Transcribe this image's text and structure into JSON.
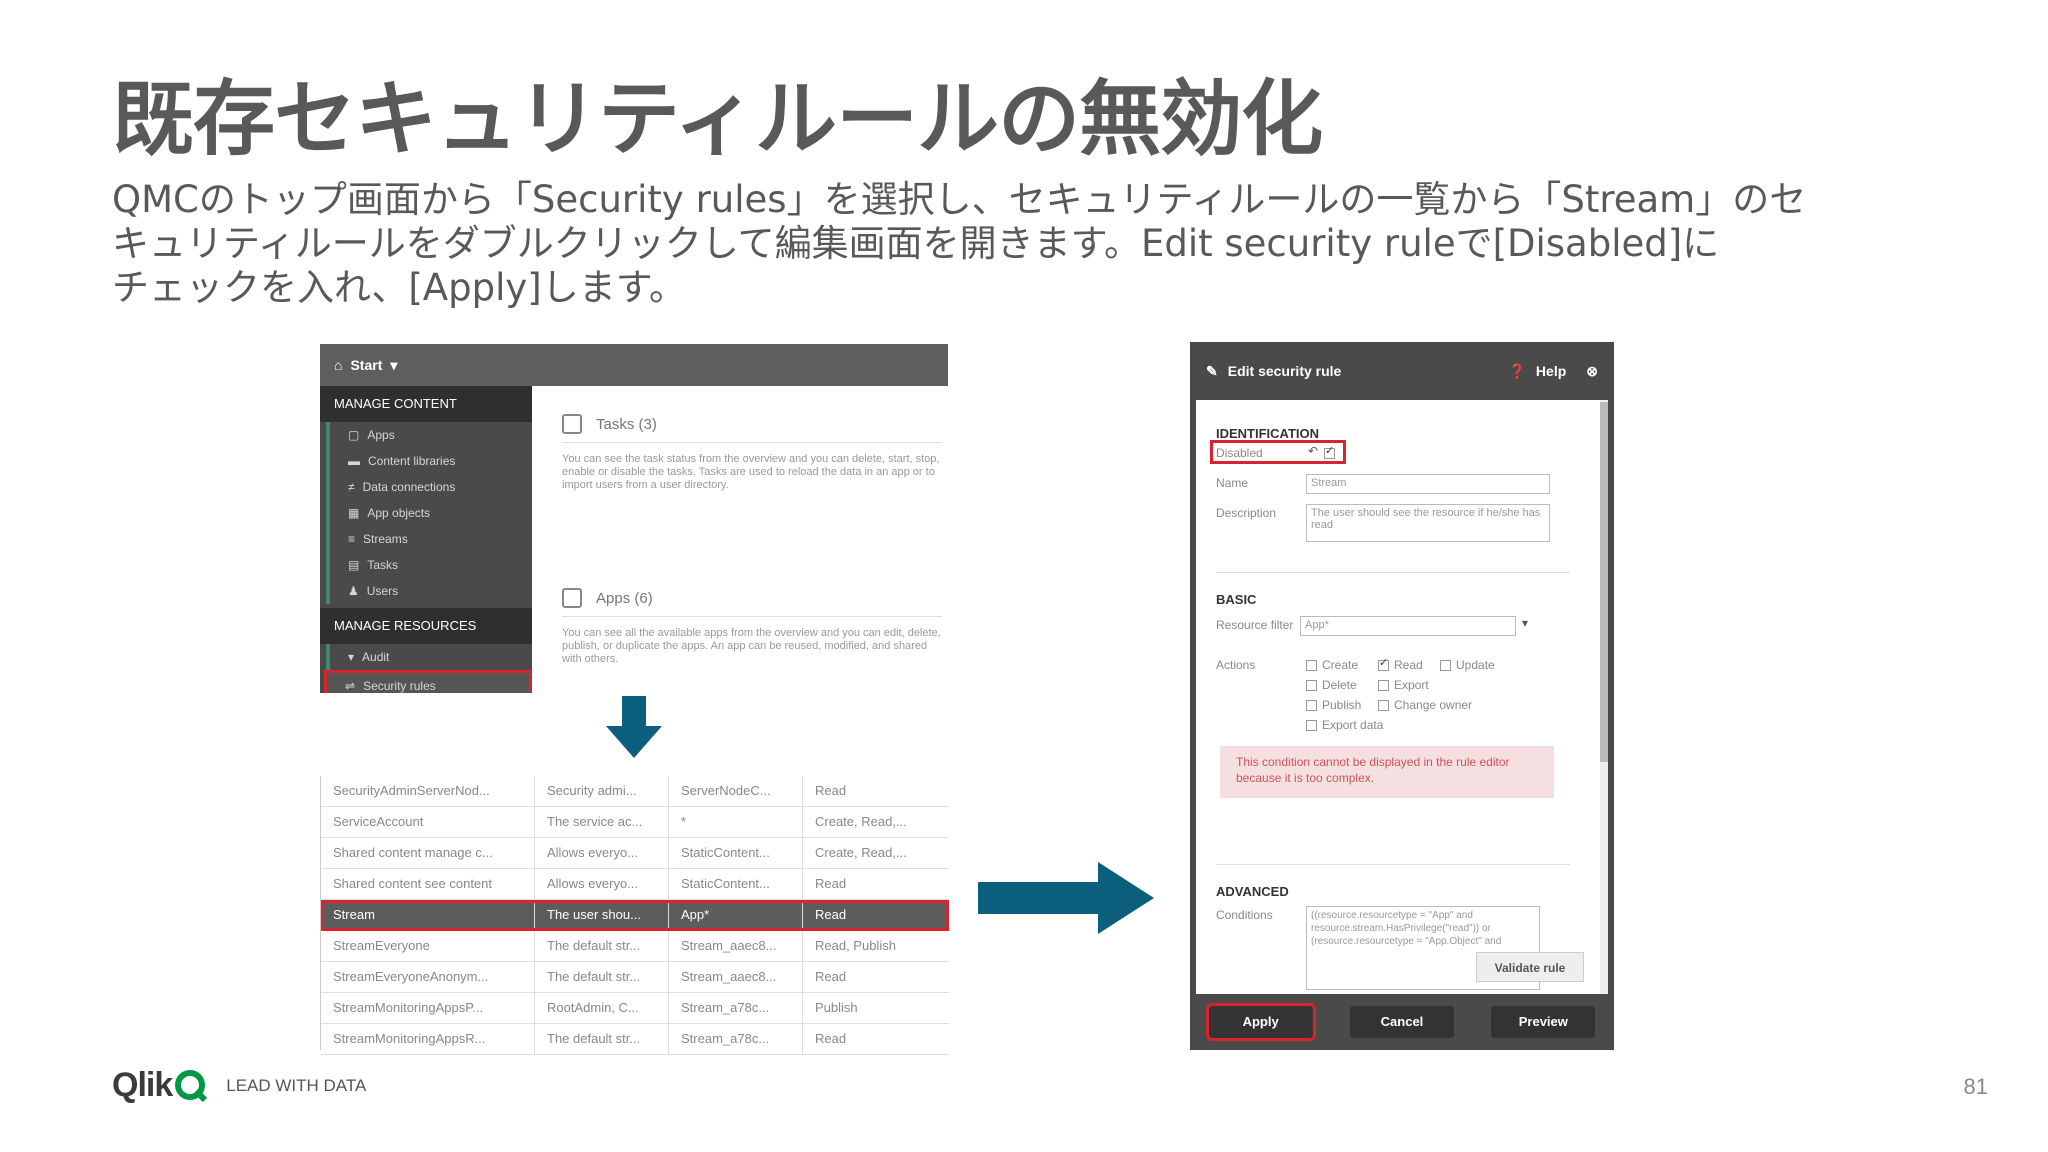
{
  "slide": {
    "title": "既存セキュリティルールの無効化",
    "body_lines": [
      "QMCのトップ画面から「Security rules」を選択し、セキュリティルールの一覧から「Stream」のセ",
      "キュリティルールをダブルクリックして編集画面を開きます。Edit security ruleで[Disabled]に",
      "チェックを入れ、[Apply]します。"
    ],
    "page_number": "81"
  },
  "qmc": {
    "start_label": "Start",
    "manage_content": "MANAGE CONTENT",
    "content_items": [
      "Apps",
      "Content libraries",
      "Data connections",
      "App objects",
      "Streams",
      "Tasks",
      "Users"
    ],
    "manage_resources": "MANAGE RESOURCES",
    "resource_items": [
      "Audit",
      "Security rules"
    ],
    "tasks_title": "Tasks (3)",
    "tasks_desc": "You can see the task status from the overview and you can delete, start, stop, enable or disable the tasks. Tasks are used to reload the data in an app or to import users from a user directory.",
    "apps_title": "Apps (6)",
    "apps_desc": "You can see all the available apps from the overview and you can edit, delete, publish, or duplicate the apps. An app can be reused, modified, and shared with others."
  },
  "rules_table": {
    "rows": [
      [
        "SecurityAdminServerNod...",
        "Security admi...",
        "ServerNodeC...",
        "Read"
      ],
      [
        "ServiceAccount",
        "The service ac...",
        "*",
        "Create, Read,..."
      ],
      [
        "Shared content manage c...",
        "Allows everyo...",
        "StaticContent...",
        "Create, Read,..."
      ],
      [
        "Shared content see content",
        "Allows everyo...",
        "StaticContent...",
        "Read"
      ],
      [
        "Stream",
        "The user shou...",
        "App*",
        "Read"
      ],
      [
        "StreamEveryone",
        "The default str...",
        "Stream_aaec8...",
        "Read, Publish"
      ],
      [
        "StreamEveryoneAnonym...",
        "The default str...",
        "Stream_aaec8...",
        "Read"
      ],
      [
        "StreamMonitoringAppsP...",
        "RootAdmin, C...",
        "Stream_a78c...",
        "Publish"
      ],
      [
        "StreamMonitoringAppsR...",
        "The default str...",
        "Stream_a78c...",
        "Read"
      ]
    ],
    "selected_index": 4
  },
  "dialog": {
    "title": "Edit security rule",
    "help": "Help",
    "identification": "IDENTIFICATION",
    "disabled_label": "Disabled",
    "name_label": "Name",
    "name_value": "Stream",
    "description_label": "Description",
    "description_value": "The user should see the resource if he/she has read",
    "basic": "BASIC",
    "resource_filter_label": "Resource filter",
    "resource_filter_value": "App*",
    "actions_label": "Actions",
    "actions": {
      "create": "Create",
      "read": "Read",
      "update": "Update",
      "delete": "Delete",
      "export": "Export",
      "publish": "Publish",
      "change_owner": "Change owner",
      "export_data": "Export data"
    },
    "warning": "This condition cannot be displayed in the rule editor because it is too complex.",
    "advanced": "ADVANCED",
    "conditions_label": "Conditions",
    "conditions_value": "((resource.resourcetype = \"App\" and resource.stream.HasPrivilege(\"read\")) or (resource.resourcetype = \"App.Object\" and",
    "validate": "Validate rule",
    "apply": "Apply",
    "cancel": "Cancel",
    "preview": "Preview"
  },
  "footer": {
    "logo_word": "Qlik",
    "tagline": "LEAD WITH DATA"
  },
  "colors": {
    "accent_red": "#d9232d",
    "arrow_teal": "#0b5e7c",
    "qlik_green": "#009845"
  }
}
